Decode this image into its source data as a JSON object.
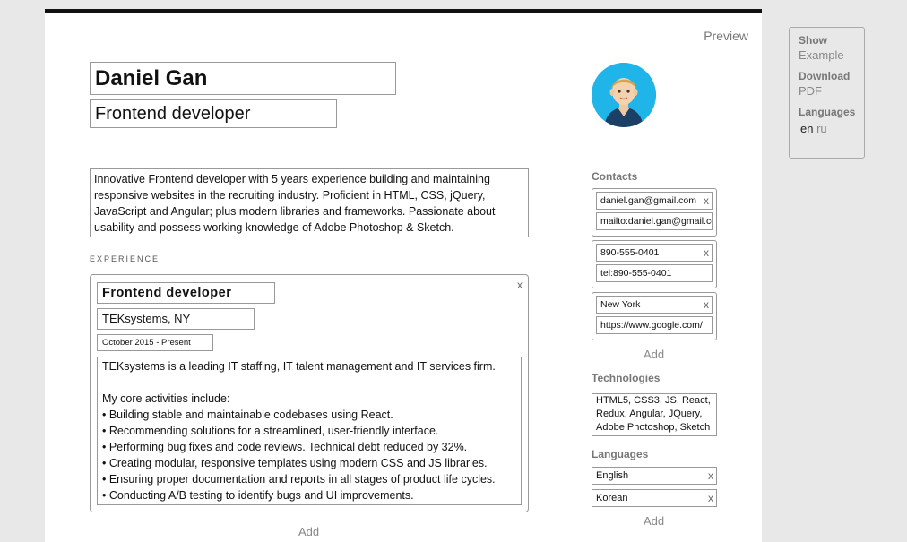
{
  "header": {
    "preview_label": "Preview",
    "name": "Daniel Gan",
    "title": "Frontend developer"
  },
  "summary": "Innovative Frontend developer with 5 years experience building and maintaining responsive websites in the recruiting industry. Proficient in HTML, CSS, jQuery, JavaScript and Angular; plus modern libraries and frameworks. Passionate about usability and possess working knowledge of Adobe Photoshop & Sketch.",
  "experience": {
    "section_label": "EXPERIENCE",
    "items": [
      {
        "role": "Frontend developer",
        "company": "TEKsystems, NY",
        "dates": "October 2015 - Present",
        "description": "TEKsystems is a leading IT staffing, IT talent management and IT services firm.\n\nMy core activities include:\n• Building stable and maintainable codebases using React.\n• Recommending solutions for a streamlined, user-friendly interface.\n• Performing bug fixes and code reviews. Technical debt reduced by 32%.\n• Creating modular, responsive templates using modern CSS and JS libraries.\n• Ensuring proper documentation and reports in all stages of product life cycles.\n• Conducting A/B testing to identify bugs and UI improvements."
      }
    ],
    "add_label": "Add"
  },
  "contacts": {
    "label": "Contacts",
    "items": [
      {
        "text": "daniel.gan@gmail.com",
        "link": "mailto:daniel.gan@gmail.com"
      },
      {
        "text": "890-555-0401",
        "link": "tel:890-555-0401"
      },
      {
        "text": "New York",
        "link": "https://www.google.com/"
      }
    ],
    "add_label": "Add"
  },
  "technologies": {
    "label": "Technologies",
    "value": "HTML5, CSS3, JS, React, Redux, Angular, JQuery, Adobe Photoshop, Sketch"
  },
  "languages": {
    "label": "Languages",
    "items": [
      "English",
      "Korean"
    ],
    "add_label": "Add"
  },
  "side_panel": {
    "show_label": "Show",
    "example_label": "Example",
    "download_label": "Download",
    "pdf_label": "PDF",
    "languages_label": "Languages",
    "lang_en": "en",
    "lang_ru": "ru"
  },
  "icons": {
    "close": "close-icon",
    "avatar": "avatar-illustration"
  },
  "colors": {
    "avatar_bg": "#1fb5e8",
    "page_bg": "#e8e8e8"
  }
}
